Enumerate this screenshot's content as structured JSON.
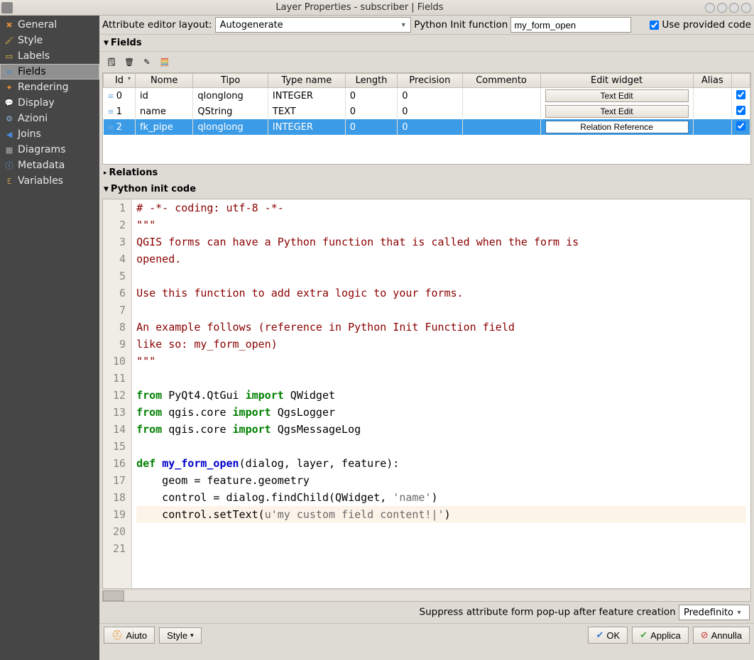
{
  "window": {
    "title": "Layer Properties - subscriber | Fields"
  },
  "sidebar": {
    "items": [
      {
        "label": "General",
        "icon": "general"
      },
      {
        "label": "Style",
        "icon": "style"
      },
      {
        "label": "Labels",
        "icon": "labels"
      },
      {
        "label": "Fields",
        "icon": "fields-sel",
        "selected": true
      },
      {
        "label": "Rendering",
        "icon": "rendering"
      },
      {
        "label": "Display",
        "icon": "display"
      },
      {
        "label": "Azioni",
        "icon": "azioni"
      },
      {
        "label": "Joins",
        "icon": "joins"
      },
      {
        "label": "Diagrams",
        "icon": "diagrams"
      },
      {
        "label": "Metadata",
        "icon": "metadata"
      },
      {
        "label": "Variables",
        "icon": "variables"
      }
    ]
  },
  "top": {
    "attr_editor_label": "Attribute editor layout:",
    "attr_editor_value": "Autogenerate",
    "py_label": "Python Init function",
    "py_value": "my_form_open",
    "provided_label": "Use provided code"
  },
  "fields": {
    "header": "Fields",
    "columns": [
      "Id",
      "Nome",
      "Tipo",
      "Type name",
      "Length",
      "Precision",
      "Commento",
      "Edit widget",
      "Alias",
      ""
    ],
    "rows": [
      {
        "id": "0",
        "nome": "id",
        "tipo": "qlonglong",
        "typename": "INTEGER",
        "length": "0",
        "precision": "0",
        "commento": "",
        "widget": "Text Edit",
        "alias": "",
        "checked": true,
        "selected": false
      },
      {
        "id": "1",
        "nome": "name",
        "tipo": "QString",
        "typename": "TEXT",
        "length": "0",
        "precision": "0",
        "commento": "",
        "widget": "Text Edit",
        "alias": "",
        "checked": true,
        "selected": false
      },
      {
        "id": "2",
        "nome": "fk_pipe",
        "tipo": "qlonglong",
        "typename": "INTEGER",
        "length": "0",
        "precision": "0",
        "commento": "",
        "widget": "Relation Reference",
        "alias": "",
        "checked": true,
        "selected": true
      }
    ]
  },
  "relations": {
    "header": "Relations"
  },
  "pycode": {
    "header": "Python init code",
    "lines": [
      {
        "n": 1,
        "html": "<span class='c-red'># -*- coding: utf-8 -*-</span>"
      },
      {
        "n": 2,
        "html": "<span class='c-red'>\"\"\"</span>"
      },
      {
        "n": 3,
        "html": "<span class='c-red'>QGIS forms can have a Python function that is called when the form is</span>"
      },
      {
        "n": 4,
        "html": "<span class='c-red'>opened.</span>"
      },
      {
        "n": 5,
        "html": ""
      },
      {
        "n": 6,
        "html": "<span class='c-red'>Use this function to add extra logic to your forms.</span>"
      },
      {
        "n": 7,
        "html": ""
      },
      {
        "n": 8,
        "html": "<span class='c-red'>An example follows (reference in Python Init Function field</span>"
      },
      {
        "n": 9,
        "html": "<span class='c-red'>like so: my_form_open)</span>"
      },
      {
        "n": 10,
        "html": "<span class='c-red'>\"\"\"</span>"
      },
      {
        "n": 11,
        "html": ""
      },
      {
        "n": 12,
        "html": "<span class='c-green'>from</span> PyQt4.QtGui <span class='c-green'>import</span> QWidget"
      },
      {
        "n": 13,
        "html": "<span class='c-green'>from</span> qgis.core <span class='c-green'>import</span> QgsLogger"
      },
      {
        "n": 14,
        "html": "<span class='c-green'>from</span> qgis.core <span class='c-green'>import</span> QgsMessageLog"
      },
      {
        "n": 15,
        "html": ""
      },
      {
        "n": 16,
        "html": "<span class='c-green'>def</span> <span class='c-blue'>my_form_open</span>(dialog, layer, feature):"
      },
      {
        "n": 17,
        "html": "    geom = feature.geometry"
      },
      {
        "n": 18,
        "html": "    control = dialog.findChild(QWidget, <span class='c-str'>'name'</span>)"
      },
      {
        "n": 19,
        "html": "    control.setText(<span class='c-str'>u'my custom field content!|'</span>)",
        "hl": true
      },
      {
        "n": 20,
        "html": ""
      },
      {
        "n": 21,
        "html": ""
      }
    ]
  },
  "suppress": {
    "label": "Suppress attribute form pop-up after feature creation",
    "value": "Predefinito"
  },
  "buttons": {
    "help": "Aiuto",
    "style": "Style",
    "ok": "OK",
    "apply": "Applica",
    "cancel": "Annulla"
  }
}
